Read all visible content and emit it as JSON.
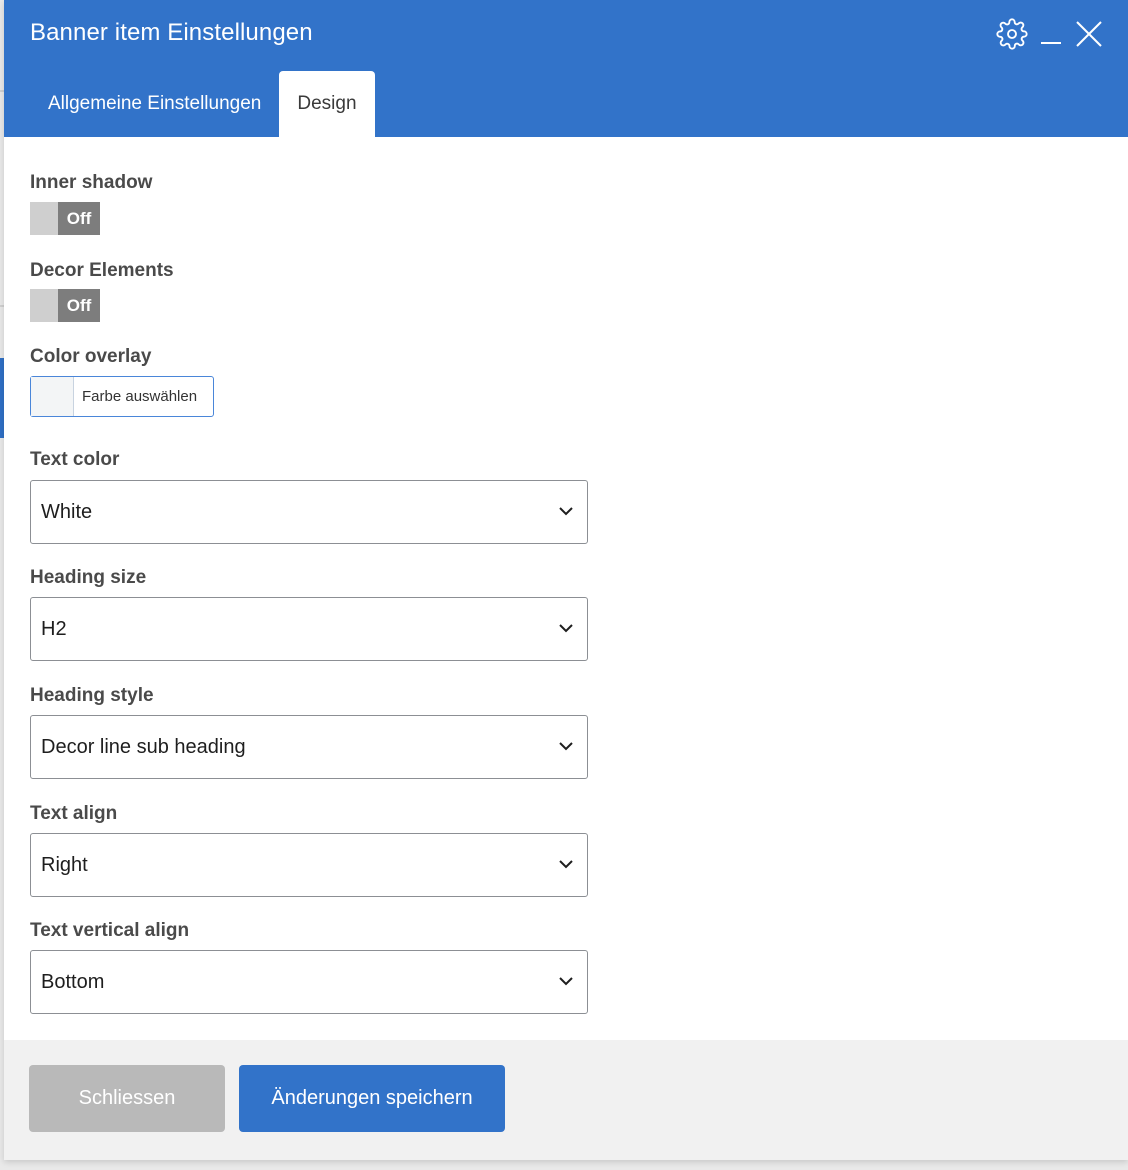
{
  "dialog": {
    "title": "Banner item Einstellungen",
    "header_color": "#3273c9",
    "icons": [
      "gear-icon",
      "minimize-icon",
      "close-icon"
    ]
  },
  "tabs": [
    {
      "label": "Allgemeine Einstellungen",
      "active": false
    },
    {
      "label": "Design",
      "active": true
    }
  ],
  "fields": {
    "inner_shadow": {
      "label": "Inner shadow",
      "toggle_state": "Off"
    },
    "decor_elements": {
      "label": "Decor Elements",
      "toggle_state": "Off"
    },
    "color_overlay": {
      "label": "Color overlay",
      "button_label": "Farbe auswählen"
    },
    "text_color": {
      "label": "Text color",
      "value": "White"
    },
    "heading_size": {
      "label": "Heading size",
      "value": "H2"
    },
    "heading_style": {
      "label": "Heading style",
      "value": "Decor line sub heading"
    },
    "text_align": {
      "label": "Text align",
      "value": "Right"
    },
    "text_vertical_align": {
      "label": "Text vertical align",
      "value": "Bottom"
    }
  },
  "footer": {
    "close_label": "Schliessen",
    "save_label": "Änderungen speichern"
  }
}
